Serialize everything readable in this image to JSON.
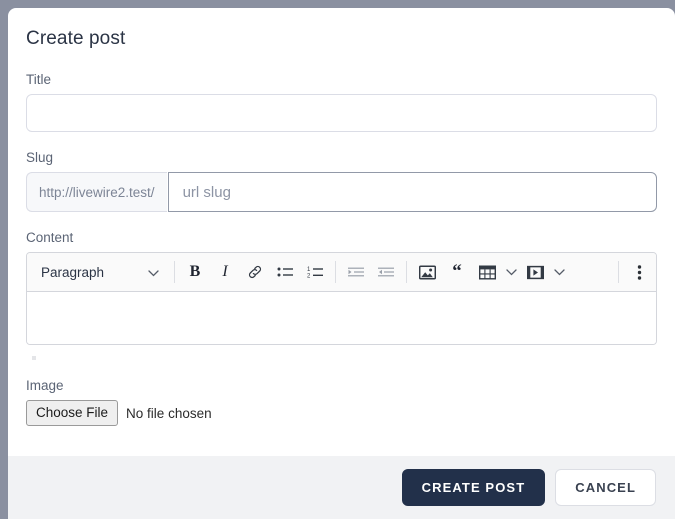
{
  "dialog": {
    "title": "Create post"
  },
  "fields": {
    "title": {
      "label": "Title",
      "value": "",
      "placeholder": ""
    },
    "slug": {
      "label": "Slug",
      "prefix": "http://livewire2.test/",
      "value": "",
      "placeholder": "url slug"
    },
    "content": {
      "label": "Content",
      "value": ""
    },
    "image": {
      "label": "Image",
      "button_label": "Choose File",
      "status": "No file chosen"
    }
  },
  "editor_toolbar": {
    "block_format": "Paragraph",
    "items": [
      {
        "name": "block-format-select",
        "label": "Paragraph"
      },
      {
        "name": "bold-icon",
        "label": "B"
      },
      {
        "name": "italic-icon",
        "label": "I"
      },
      {
        "name": "link-icon",
        "label": "Link"
      },
      {
        "name": "bullet-list-icon",
        "label": "Bulleted list"
      },
      {
        "name": "numbered-list-icon",
        "label": "Numbered list"
      },
      {
        "name": "indent-icon",
        "label": "Increase indent"
      },
      {
        "name": "outdent-icon",
        "label": "Decrease indent"
      },
      {
        "name": "image-icon",
        "label": "Insert image"
      },
      {
        "name": "blockquote-icon",
        "label": "Block quote"
      },
      {
        "name": "table-icon",
        "label": "Insert table"
      },
      {
        "name": "table-chevron-down-icon",
        "label": "Table options"
      },
      {
        "name": "video-icon",
        "label": "Insert media"
      },
      {
        "name": "video-chevron-down-icon",
        "label": "Media options"
      },
      {
        "name": "overflow-menu-icon",
        "label": "More options"
      }
    ]
  },
  "footer": {
    "submit_label": "CREATE POST",
    "cancel_label": "CANCEL"
  },
  "colors": {
    "backdrop": "#8a90a0",
    "card": "#ffffff",
    "footer_bg": "#f1f2f4",
    "primary_button": "#22304a",
    "border": "#dbdde6",
    "label_text": "#5b6475"
  }
}
